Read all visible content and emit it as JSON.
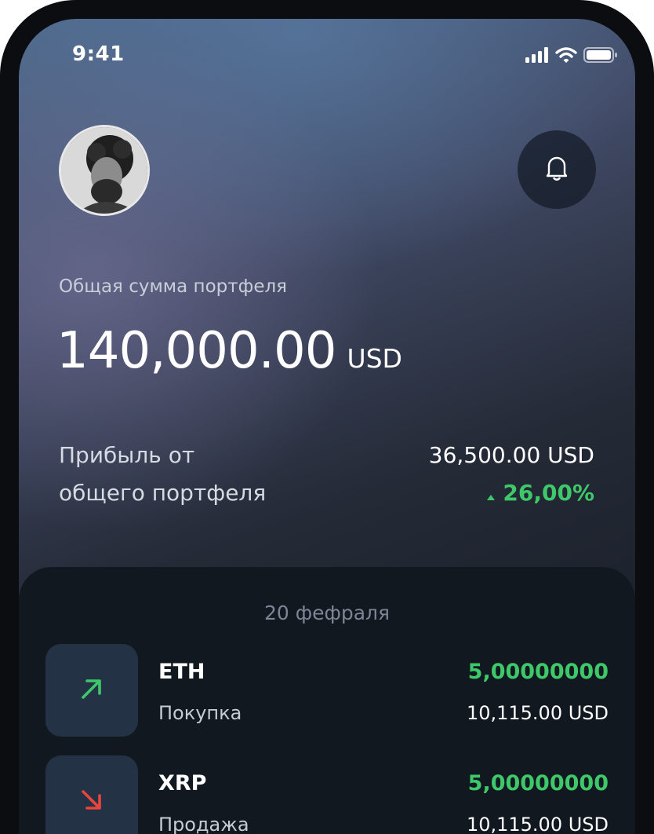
{
  "status_bar": {
    "time": "9:41",
    "icons": [
      "signal-bars-icon",
      "wifi-icon",
      "battery-icon"
    ]
  },
  "header": {
    "avatar_icon": "avatar-photo",
    "bell_icon": "bell-icon"
  },
  "portfolio": {
    "label": "Общая сумма портфеля",
    "total_amount": "140,000.00",
    "total_currency": "USD"
  },
  "profit": {
    "label_line1": "Прибыль от",
    "label_line2": "общего портфеля",
    "amount": "36,500.00 USD",
    "percent": "26,00%",
    "trend_icon": "triangle-up-icon",
    "trend_color": "#3ec86a"
  },
  "transactions": {
    "date": "20 фефраля",
    "items": [
      {
        "coin": "ETH",
        "type": "Покупка",
        "quantity": "5,00000000",
        "usd": "10,115.00 USD",
        "icon": "arrow-up-right-icon",
        "icon_color": "#3ec86a"
      },
      {
        "coin": "XRP",
        "type": "Продажа",
        "quantity": "5,00000000",
        "usd": "10,115.00 USD",
        "icon": "arrow-down-right-icon",
        "icon_color": "#e8453c"
      }
    ]
  },
  "colors": {
    "accent_green": "#3ec86a",
    "accent_red": "#e8453c",
    "panel_bg": "#121820",
    "icon_box_bg": "#243245"
  }
}
